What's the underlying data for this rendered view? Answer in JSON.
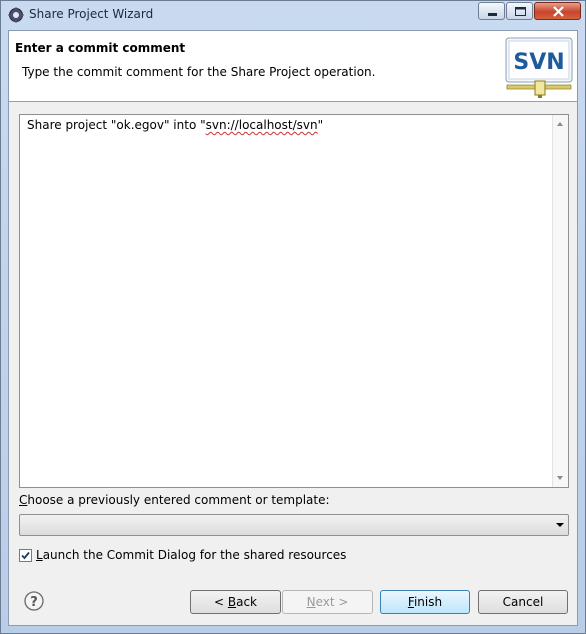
{
  "window": {
    "title": "Share Project Wizard"
  },
  "header": {
    "title": "Enter a commit comment",
    "description": "Type the commit comment for the Share Project operation.",
    "logo_text": "SVN"
  },
  "comment": {
    "prefix": "Share project \"ok.egov\" into \"",
    "url": "svn://localhost/svn",
    "suffix": "\""
  },
  "template": {
    "label_first": "C",
    "label_rest": "hoose a previously entered comment or template:",
    "selected": ""
  },
  "launch_commit": {
    "checked": true,
    "label_first": "L",
    "label_rest": "aunch the Commit Dialog for the shared resources"
  },
  "buttons": {
    "back_pre": "< ",
    "back_mn": "B",
    "back_post": "ack",
    "next_mn": "N",
    "next_post": "ext >",
    "finish_mn": "F",
    "finish_post": "inish",
    "cancel": "Cancel"
  },
  "colors": {
    "accent": "#3c7fb1",
    "svn_blue": "#1e5a9c",
    "close_red": "#c8452b"
  }
}
